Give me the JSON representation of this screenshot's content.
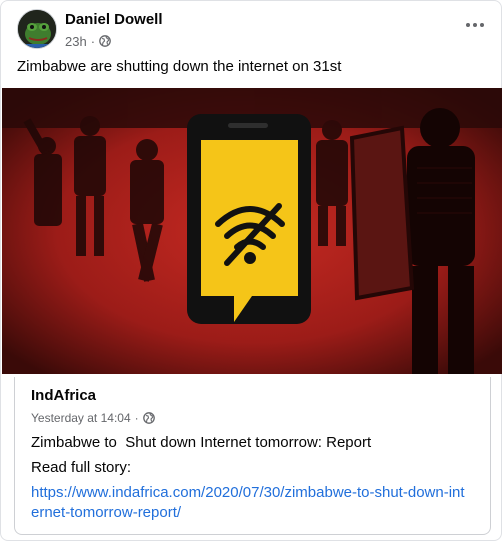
{
  "post": {
    "author": "Daniel Dowell",
    "timestamp": "23h",
    "separator": "·",
    "privacy_icon": "globe-icon",
    "more_icon": "more-options-icon",
    "text": "Zimbabwe are shutting down the internet on 31st"
  },
  "shared_post": {
    "author": "IndAfrica",
    "timestamp": "Yesterday at 14:04",
    "separator": "·",
    "privacy_icon": "globe-icon",
    "headline": "Zimbabwe to  Shut down Internet tomorrow: Report",
    "read_more": "Read full story:",
    "link": "https://www.indafrica.com/2020/07/30/zimbabwe-to-shut-down-internet-tomorrow-report/",
    "image_icon": "no-wifi-icon"
  },
  "colors": {
    "image_red": "#b3201c",
    "phone_black": "#111111",
    "screen_yellow": "#f5c518",
    "link_blue": "#216fdb",
    "secondary_text": "#65676b"
  }
}
